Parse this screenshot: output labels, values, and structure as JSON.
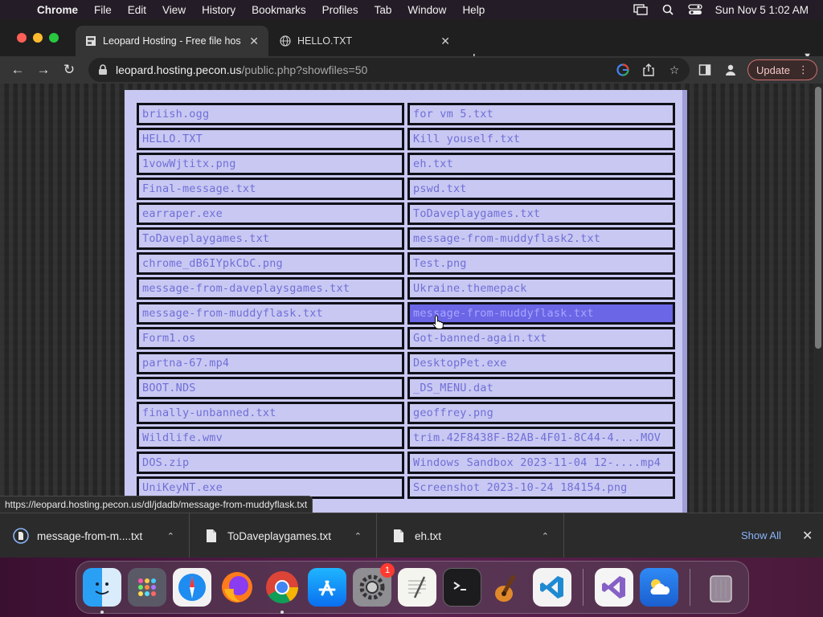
{
  "menubar": {
    "app_name": "Chrome",
    "items": [
      "File",
      "Edit",
      "View",
      "History",
      "Bookmarks",
      "Profiles",
      "Tab",
      "Window",
      "Help"
    ],
    "clock": "Sun Nov 5  1:02 AM"
  },
  "tabs": [
    {
      "title": "Leopard Hosting - Free file hos",
      "active": true
    },
    {
      "title": "HELLO.TXT",
      "active": false
    }
  ],
  "toolbar": {
    "url_host": "leopard.hosting.pecon.us",
    "url_rest": "/public.php?showfiles=50",
    "update_label": "Update"
  },
  "files": {
    "left": [
      "briish.ogg",
      "HELLO.TXT",
      "1vowWjtitx.png",
      "Final-message.txt",
      "earraper.exe",
      "ToDaveplaygames.txt",
      "chrome_dB6IYpkCbC.png",
      "message-from-daveplaysgames.txt",
      "message-from-muddyflask.txt",
      "Form1.os",
      "partna-67.mp4",
      "BOOT.NDS",
      "finally-unbanned.txt",
      "Wildlife.wmv",
      "DOS.zip",
      "UniKeyNT.exe"
    ],
    "right": [
      "for vm 5.txt",
      "Kill youself.txt",
      "eh.txt",
      "pswd.txt",
      "ToDaveplaygames.txt",
      "message-from-muddyflask2.txt",
      "Test.png",
      "Ukraine.themepack",
      "message-from-muddyflask.txt",
      "Got-banned-again.txt",
      "DesktopPet.exe",
      "_DS_MENU.dat",
      "geoffrey.png",
      "trim.42F8438F-B2AB-4F01-8C44-4....MOV",
      "Windows Sandbox 2023-11-04 12-....mp4",
      "Screenshot 2023-10-24 184154.png"
    ]
  },
  "status_url": "https://leopard.hosting.pecon.us/dl/jdadb/message-from-muddyflask.txt",
  "downloads": {
    "items": [
      "message-from-m....txt",
      "ToDaveplaygames.txt",
      "eh.txt"
    ],
    "show_all": "Show All"
  },
  "dock": {
    "settings_badge": "1"
  }
}
